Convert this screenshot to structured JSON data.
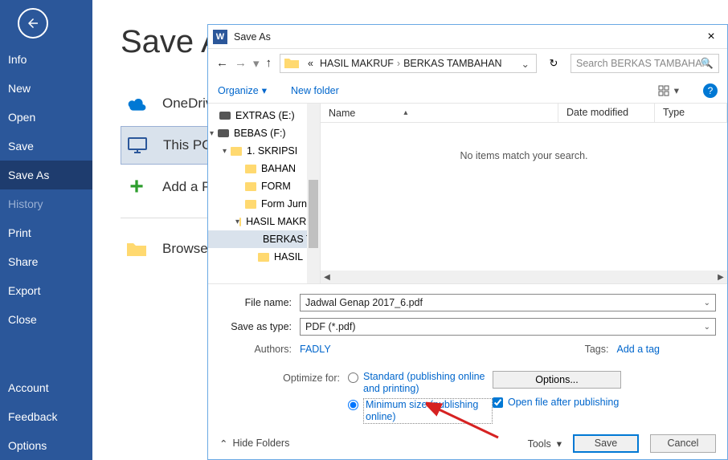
{
  "word": {
    "title": "Save As",
    "sidebar": [
      "Info",
      "New",
      "Open",
      "Save",
      "Save As",
      "History",
      "Print",
      "Share",
      "Export",
      "Close",
      "Account",
      "Feedback",
      "Options"
    ],
    "selected_idx": 4,
    "dim_idx": 5,
    "locations": {
      "onedrive": "OneDrive",
      "thispc": "This PC",
      "addplace": "Add a Place",
      "browse": "Browse"
    }
  },
  "dialog": {
    "title": "Save As",
    "nav": {
      "back": "←",
      "fwd": "→",
      "up": "↑"
    },
    "breadcrumb": {
      "pre": "«",
      "a": "HASIL MAKRUF",
      "b": "BERKAS TAMBAHAN"
    },
    "search_placeholder": "Search BERKAS TAMBAHAN",
    "organize": "Organize",
    "newfolder": "New folder",
    "columns": {
      "name": "Name",
      "date": "Date modified",
      "type": "Type"
    },
    "empty_msg": "No items match your search.",
    "tree": [
      {
        "label": "EXTRAS (E:)",
        "level": 0,
        "drive": true,
        "chev": ""
      },
      {
        "label": "BEBAS (F:)",
        "level": 0,
        "drive": true,
        "chev": "▾"
      },
      {
        "label": "1. SKRIPSI",
        "level": 1,
        "chev": "▾"
      },
      {
        "label": "BAHAN",
        "level": 2
      },
      {
        "label": "FORM",
        "level": 2
      },
      {
        "label": "Form Jurnal",
        "level": 2
      },
      {
        "label": "HASIL MAKRUF",
        "level": 2,
        "chev": "▾",
        "cut": true
      },
      {
        "label": "BERKAS TAMBAHAN",
        "level": 3,
        "sel": true,
        "cut": true
      },
      {
        "label": "HASIL",
        "level": 3
      }
    ],
    "filename_lbl": "File name:",
    "filename_val": "Jadwal Genap 2017_6.pdf",
    "savetype_lbl": "Save as type:",
    "savetype_val": "PDF (*.pdf)",
    "authors_lbl": "Authors:",
    "authors_val": "FADLY",
    "tags_lbl": "Tags:",
    "tags_val": "Add a tag",
    "optimize_lbl": "Optimize for:",
    "radio_standard": "Standard (publishing online and printing)",
    "radio_min": "Minimum size (publishing online)",
    "options_btn": "Options...",
    "openafter": "Open file after publishing",
    "hide_folders": "Hide Folders",
    "tools": "Tools",
    "save": "Save",
    "cancel": "Cancel"
  }
}
